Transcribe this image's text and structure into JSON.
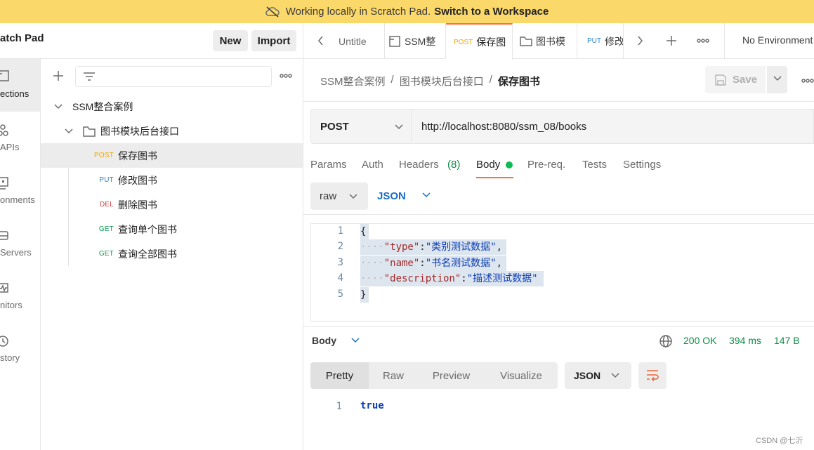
{
  "banner": {
    "text": "Working locally in Scratch Pad.",
    "link": "Switch to a Workspace"
  },
  "workspace": {
    "title": "atch Pad",
    "new_label": "New",
    "import_label": "Import"
  },
  "rail": {
    "items": [
      "ections",
      "APIs",
      "onments",
      "Servers",
      "nitors",
      "story"
    ]
  },
  "tree": {
    "collection": "SSM整合案例",
    "folder": "图书模块后台接口",
    "requests": [
      {
        "method": "POST",
        "name": "保存图书"
      },
      {
        "method": "PUT",
        "name": "修改图书"
      },
      {
        "method": "DEL",
        "name": "删除图书"
      },
      {
        "method": "GET",
        "name": "查询单个图书"
      },
      {
        "method": "GET",
        "name": "查询全部图书"
      }
    ]
  },
  "tabs": [
    {
      "label": "Untitle"
    },
    {
      "label": "SSM整"
    },
    {
      "method": "POST",
      "label": "保存图"
    },
    {
      "label": "图书模"
    },
    {
      "method": "PUT",
      "label": "修改"
    }
  ],
  "environment": "No Environment",
  "breadcrumb": [
    "SSM整合案例",
    "/",
    "图书模块后台接口",
    "/",
    "保存图书"
  ],
  "save_label": "Save",
  "request": {
    "method": "POST",
    "url": "http://localhost:8080/ssm_08/books"
  },
  "request_tabs": [
    "Params",
    "Auth",
    "Headers",
    "(8)",
    "Body",
    "Pre-req.",
    "Tests",
    "Settings"
  ],
  "body_mode": "raw",
  "body_lang": "JSON",
  "editor": {
    "line_numbers": [
      "1",
      "2",
      "3",
      "4",
      "5"
    ],
    "lines": [
      {
        "dots": "",
        "key": "",
        "value": "",
        "text": "{"
      },
      {
        "dots": "····",
        "key": "\"type\"",
        "value": "\"类别测试数据\"",
        "text": ""
      },
      {
        "dots": "····",
        "key": "\"name\"",
        "value": "\"书名测试数据\"",
        "text": ""
      },
      {
        "dots": "····",
        "key": "\"description\"",
        "value": "\"描述测试数据\"",
        "text": ""
      },
      {
        "dots": "",
        "key": "",
        "value": "",
        "text": "}"
      }
    ]
  },
  "response": {
    "label": "Body",
    "status": "200 OK",
    "time": "394 ms",
    "size": "147 B",
    "views": [
      "Pretty",
      "Raw",
      "Preview",
      "Visualize"
    ],
    "format": "JSON",
    "line_number": "1",
    "value": "true"
  },
  "watermark": "CSDN @七沂",
  "colors": {
    "banner": "#fbd86a",
    "accent": "#ff6c37",
    "post": "#f0a500",
    "put": "#2a80c6",
    "del": "#d14040",
    "get": "#0c9b4f",
    "status_ok": "#0c8a44"
  }
}
